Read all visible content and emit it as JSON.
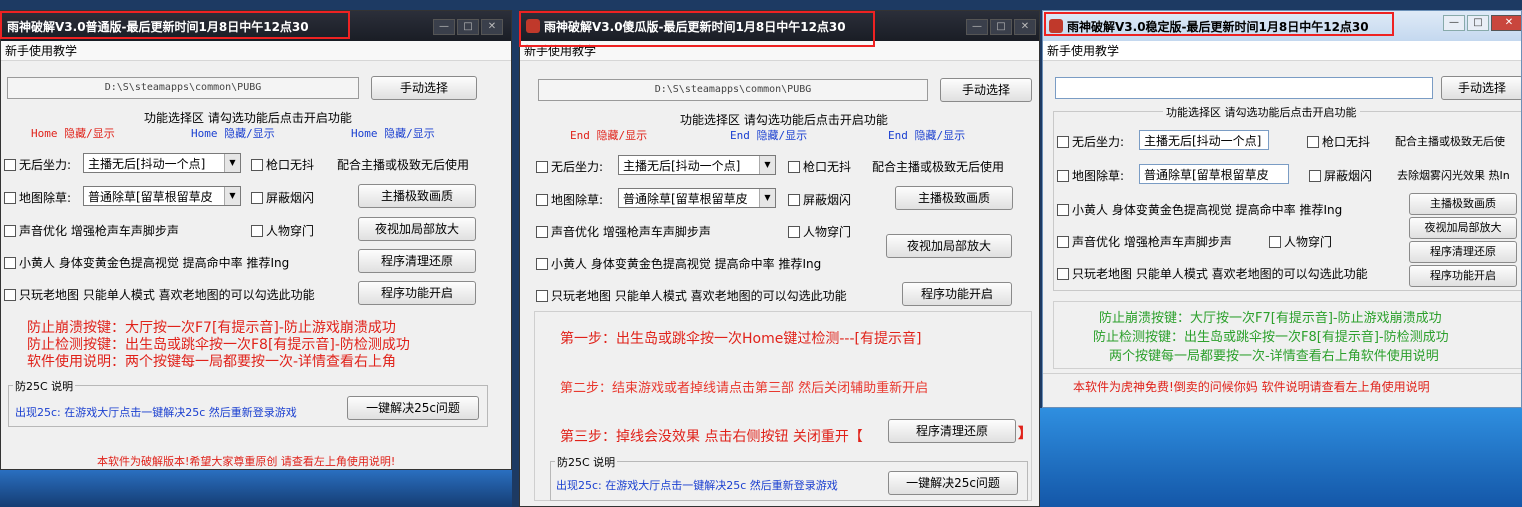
{
  "windows": [
    {
      "title": "雨神破解V3.0普通版-最后更新时间1月8日中午12点30",
      "menu": "新手使用教学",
      "path": "D:\\S\\steamapps\\common\\PUBG",
      "manual_select": "手动选择",
      "section_title": "功能选择区 请勾选功能后点击开启功能",
      "hotkeys": [
        "Home 隐藏/显示",
        "Home 隐藏/显示",
        "Home 隐藏/显示"
      ],
      "opt_recoil": "无后坐力:",
      "recoil_combo": "主播无后[抖动一个点]",
      "opt_nosway": "枪口无抖",
      "recoil_note": "配合主播或极致无后使用",
      "opt_grass": "地图除草:",
      "grass_combo": "普通除草[留草根留草皮",
      "opt_noflash": "屏蔽烟闪",
      "btn_quality": "主播极致画质",
      "opt_sound": "声音优化 增强枪声车声脚步声",
      "opt_wallhack": "人物穿门",
      "btn_nightvision": "夜视加局部放大",
      "opt_yellow": "小黄人 身体变黄金色提高视觉 提高命中率 推荐Ing",
      "btn_restore": "程序清理还原",
      "opt_oldmap": "只玩老地图 只能单人模式 喜欢老地图的可以勾选此功能",
      "btn_start": "程序功能开启",
      "notices": [
        "防止崩溃按键：大厅按一次F7[有提示音]-防止游戏崩溃成功",
        "防止检测按键：出生岛或跳伞按一次F8[有提示音]-防检测成功",
        "软件使用说明：两个按键每一局都要按一次-详情查看右上角"
      ],
      "fix25_legend": "防25C 说明",
      "fix25_text": "出现25c: 在游戏大厅点击一键解决25c 然后重新登录游戏",
      "fix25_button": "一键解决25c问题",
      "footer": "本软件为破解版本!希望大家尊重原创 请查看左上角使用说明!"
    },
    {
      "title": "雨神破解V3.0傻瓜版-最后更新时间1月8日中午12点30",
      "menu": "新手使用教学",
      "path": "D:\\S\\steamapps\\common\\PUBG",
      "manual_select": "手动选择",
      "section_title": "功能选择区 请勾选功能后点击开启功能",
      "hotkeys": [
        "End 隐藏/显示",
        "End 隐藏/显示",
        "End 隐藏/显示"
      ],
      "opt_recoil": "无后坐力:",
      "recoil_combo": "主播无后[抖动一个点]",
      "opt_nosway": "枪口无抖",
      "recoil_note": "配合主播或极致无后使用",
      "opt_grass": "地图除草:",
      "grass_combo": "普通除草[留草根留草皮",
      "opt_noflash": "屏蔽烟闪",
      "btn_quality": "主播极致画质",
      "opt_sound": "声音优化 增强枪声车声脚步声",
      "opt_wallhack": "人物穿门",
      "btn_nightvision": "夜视加局部放大",
      "opt_yellow": "小黄人 身体变黄金色提高视觉 提高命中率 推荐Ing",
      "opt_oldmap": "只玩老地图 只能单人模式 喜欢老地图的可以勾选此功能",
      "btn_start": "程序功能开启",
      "step1": "第一步：出生岛或跳伞按一次Home键过检测---[有提示音]",
      "step2": "第二步：结束游戏或者掉线请点击第三部 然后关闭辅助重新开启",
      "step3": "第三步：掉线会没效果 点击右侧按钮 关闭重开【",
      "step3_end": "】",
      "btn_restore": "程序清理还原",
      "fix25_legend": "防25C 说明",
      "fix25_text": "出现25c: 在游戏大厅点击一键解决25c 然后重新登录游戏",
      "fix25_button": "一键解决25c问题"
    },
    {
      "title": "雨神破解V3.0稳定版-最后更新时间1月8日中午12点30",
      "menu": "新手使用教学",
      "path": "",
      "manual_select": "手动选择",
      "section_title": "功能选择区 请勾选功能后点击开启功能",
      "opt_recoil": "无后坐力:",
      "recoil_combo": "主播无后[抖动一个点]",
      "opt_nosway": "枪口无抖",
      "recoil_note": "配合主播或极致无后使",
      "opt_grass": "地图除草:",
      "grass_combo": "普通除草[留草根留草皮",
      "opt_noflash": "屏蔽烟闪",
      "grass_note": "去除烟雾闪光效果 热In",
      "opt_yellow": "小黄人 身体变黄金色提高视觉 提高命中率 推荐Ing",
      "btn_quality": "主播极致画质",
      "opt_sound": "声音优化 增强枪声车声脚步声",
      "opt_wallhack": "人物穿门",
      "btn_nightvision": "夜视加局部放大",
      "btn_restore": "程序清理还原",
      "opt_oldmap": "只玩老地图 只能单人模式 喜欢老地图的可以勾选此功能",
      "btn_start": "程序功能开启",
      "notices": [
        "防止崩溃按键：大厅按一次F7[有提示音]-防止游戏崩溃成功",
        "防止检测按键：出生岛或跳伞按一次F8[有提示音]-防检测成功",
        "两个按键每一局都要按一次-详情查看右上角软件使用说明"
      ],
      "footer": "本软件为虎神免费!倒卖的问候你妈 软件说明请查看左上角使用说明"
    }
  ],
  "window_controls": {
    "minimize": "—",
    "maximize": "□",
    "close": "✕"
  },
  "colors": {
    "highlight_box": "#e22222",
    "warning_text": "#e0221a",
    "info_text": "#1a3fd0"
  }
}
